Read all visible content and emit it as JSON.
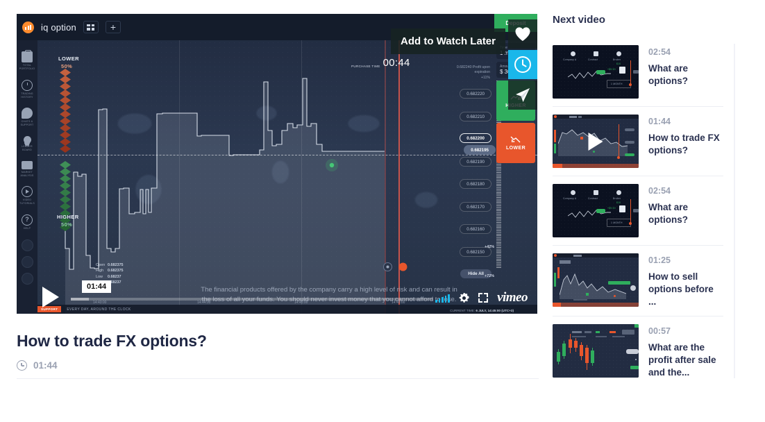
{
  "player": {
    "tooltip": "Add to Watch Later",
    "time_bubble": "01:44",
    "overlay_buttons": [
      {
        "name": "like-heart",
        "icon": "heart-icon"
      },
      {
        "name": "watch-later",
        "icon": "clock-icon"
      },
      {
        "name": "share",
        "icon": "paper-plane-icon"
      }
    ],
    "brand": "vimeo",
    "disclaimer_line1": "The financial products offered by the company carry a high level of risk and can result in",
    "disclaimer_line2": "the loss of all your funds. You should never invest money that you cannot afford to lose.",
    "accent": "#1ab7ea"
  },
  "app": {
    "brand": "iq option",
    "sidebar": [
      {
        "label": "TOTAL PORTFOLIO",
        "icon": "briefcase-icon"
      },
      {
        "label": "TRADING HISTORY",
        "icon": "clock-icon"
      },
      {
        "label": "CHATS & SUPPORT",
        "icon": "chat-icon"
      },
      {
        "label": "LEADER BOARD",
        "icon": "award-icon"
      },
      {
        "label": "MARKET ANALYSIS",
        "icon": "news-icon"
      },
      {
        "label": "VIDEO TUTORIALS",
        "icon": "play-circle-icon"
      },
      {
        "label": "HELP",
        "icon": "question-icon"
      }
    ],
    "ladder_lower": {
      "label": "LOWER",
      "percent": "50%"
    },
    "ladder_higher": {
      "label": "HIGHER",
      "percent": "50%"
    },
    "purchase_label": "PURCHASE TIME",
    "purchase_time": "00:44",
    "ohlc": [
      {
        "key": "Open",
        "value": "0.682375"
      },
      {
        "key": "High",
        "value": "0.682375"
      },
      {
        "key": "Low",
        "value": "0.68237"
      },
      {
        "key": "Close",
        "value": "0.68237"
      }
    ],
    "time_axis": [
      "14:43:00",
      "14:44:00",
      "14:45:00",
      "14:46:00"
    ],
    "price_labels": [
      "0.682220",
      "0.682210",
      "0.682200",
      "0.682195",
      "0.682190",
      "0.682180",
      "0.682170",
      "0.682160",
      "0.682150"
    ],
    "price_active": "0.682200",
    "price_current": "0.682195",
    "hide_all": "Hide All",
    "pct_top": "+42%",
    "pct_bottom": "+72%",
    "deposit": "Deposit",
    "profit_note_line1": "0.682240   Profit upon",
    "profit_note_line2": "expiration",
    "profit_note_line3": "+11%",
    "time_box_label": "Time",
    "time_box_value": "1 m",
    "amount_box_label": "Amount",
    "amount_box_value": "$ 30",
    "btn_higher": "HIGHER",
    "btn_lower": "LOWER",
    "support_tag": "SUPPORT",
    "support_text": "EVERY DAY, AROUND THE CLOCK",
    "current_time_label": "CURRENT TIME:",
    "current_time_value": "6 JULY, 14:45:00 (UTC+3)",
    "colors": {
      "green": "#2fae5d",
      "red": "#e8562c",
      "panel": "#192132"
    }
  },
  "video_meta": {
    "title": "How to trade FX options?",
    "duration": "01:44",
    "clock_icon": "clock-icon"
  },
  "next_video": {
    "heading": "Next video",
    "items": [
      {
        "duration": "02:54",
        "title": "What are options?",
        "thumb": "contract",
        "playing": false
      },
      {
        "duration": "01:44",
        "title": "How to trade FX options?",
        "thumb": "fxchart",
        "playing": true
      },
      {
        "duration": "02:54",
        "title": "What are options?",
        "thumb": "contract",
        "playing": false
      },
      {
        "duration": "01:25",
        "title": "How to sell options before ...",
        "thumb": "areachart",
        "playing": false
      },
      {
        "duration": "00:57",
        "title": "What are the profit after sale and the...",
        "thumb": "candles",
        "playing": false
      }
    ]
  }
}
